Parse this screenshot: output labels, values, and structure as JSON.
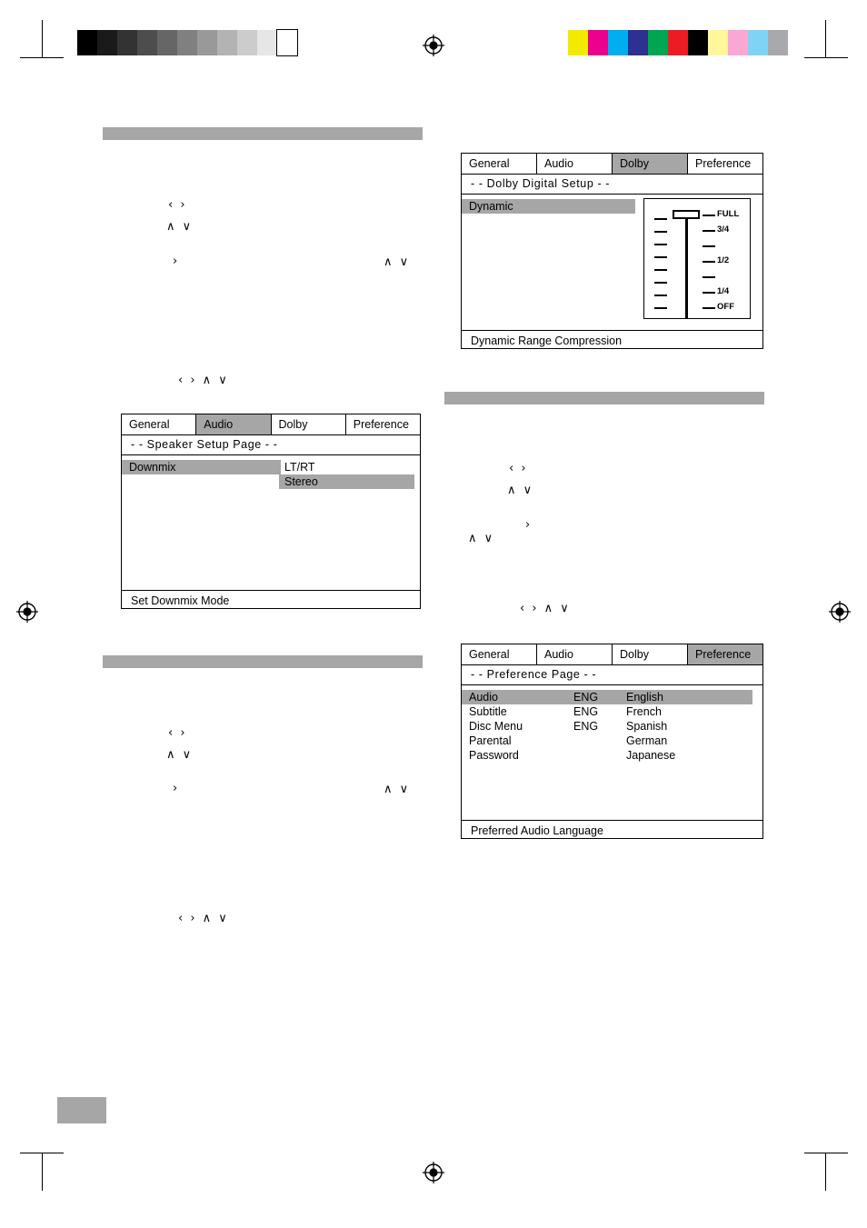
{
  "print_marks": {
    "grayscale_patches": [
      "#000000",
      "#1a1a1a",
      "#333333",
      "#4d4d4d",
      "#666666",
      "#808080",
      "#999999",
      "#b3b3b3",
      "#cccccc",
      "#e6e6e6",
      "#ffffff"
    ],
    "color_patches": [
      "#f2ea00",
      "#ec008c",
      "#00aeef",
      "#2e3192",
      "#00a651",
      "#ed1c24",
      "#000000",
      "#fff799",
      "#f9a8d4",
      "#7fd4f5",
      "#a7a9ac"
    ]
  },
  "sections": {
    "speaker_setup_heading": "",
    "dolby_heading": "",
    "preference_heading": ""
  },
  "glyphs": {
    "lr": "‹    ›",
    "ud": "∧    ∨",
    "right": "›",
    "ud2": "∧     ∨",
    "all": "‹    ›    ∧    ∨"
  },
  "osd_speaker": {
    "tabs": [
      {
        "label": "General",
        "selected": false
      },
      {
        "label": "Audio",
        "selected": true
      },
      {
        "label": "Dolby",
        "selected": false
      },
      {
        "label": "Preference",
        "selected": false
      }
    ],
    "title": "- -  Speaker  Setup  Page  - -",
    "items": [
      {
        "label": "Downmix",
        "highlight": true
      }
    ],
    "options": [
      {
        "label": "LT/RT",
        "highlight": false
      },
      {
        "label": "Stereo",
        "highlight": true
      }
    ],
    "footer": "Set Downmix Mode"
  },
  "osd_dolby": {
    "tabs": [
      {
        "label": "General",
        "selected": false
      },
      {
        "label": "Audio",
        "selected": false
      },
      {
        "label": "Dolby",
        "selected": true
      },
      {
        "label": "Preference",
        "selected": false
      }
    ],
    "title": "- -  Dolby  Digital  Setup  - -",
    "items": [
      {
        "label": "Dynamic",
        "highlight": true
      }
    ],
    "slider": {
      "labels": [
        "FULL",
        "3/4",
        "1/2",
        "1/4",
        "OFF"
      ],
      "value": "FULL",
      "steps": 9
    },
    "footer": "Dynamic Range Compression"
  },
  "osd_preference": {
    "tabs": [
      {
        "label": "General",
        "selected": false
      },
      {
        "label": "Audio",
        "selected": false
      },
      {
        "label": "Dolby",
        "selected": false
      },
      {
        "label": "Preference",
        "selected": true
      }
    ],
    "title": "- -  Preference  Page  - -",
    "items": [
      {
        "label": "Audio",
        "value": "ENG",
        "highlight": true
      },
      {
        "label": "Subtitle",
        "value": "ENG",
        "highlight": false
      },
      {
        "label": "Disc Menu",
        "value": "ENG",
        "highlight": false
      },
      {
        "label": "Parental",
        "value": "",
        "highlight": false
      },
      {
        "label": "Password",
        "value": "",
        "highlight": false
      }
    ],
    "options": [
      {
        "label": "English",
        "highlight": true
      },
      {
        "label": "French",
        "highlight": false
      },
      {
        "label": "Spanish",
        "highlight": false
      },
      {
        "label": "German",
        "highlight": false
      },
      {
        "label": "Japanese",
        "highlight": false
      }
    ],
    "footer": "Preferred Audio Language"
  }
}
